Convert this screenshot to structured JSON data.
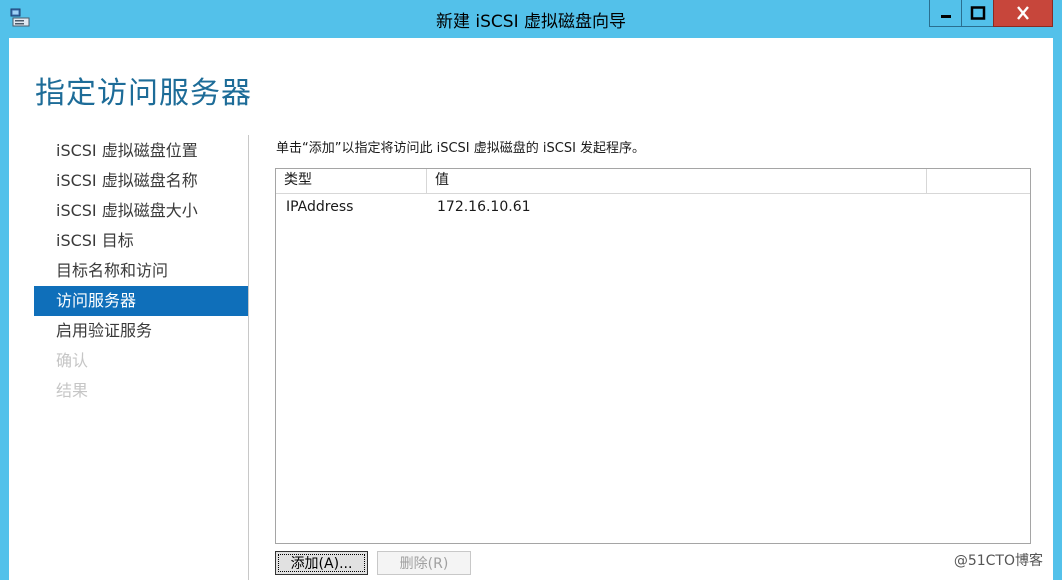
{
  "window": {
    "title": "新建 iSCSI 虚拟磁盘向导",
    "title_bar_color": "#53c1ea",
    "close_color": "#c7463b",
    "buttons": {
      "minimize_icon": "minimize-icon",
      "maximize_icon": "maximize-icon",
      "close_icon": "close-icon"
    }
  },
  "page": {
    "title": "指定访问服务器",
    "accent_color": "#1d6c98"
  },
  "steps": [
    {
      "label": "iSCSI 虚拟磁盘位置",
      "state": "done"
    },
    {
      "label": "iSCSI 虚拟磁盘名称",
      "state": "done"
    },
    {
      "label": "iSCSI 虚拟磁盘大小",
      "state": "done"
    },
    {
      "label": "iSCSI 目标",
      "state": "done"
    },
    {
      "label": "目标名称和访问",
      "state": "done"
    },
    {
      "label": "访问服务器",
      "state": "active"
    },
    {
      "label": "启用验证服务",
      "state": "pending"
    },
    {
      "label": "确认",
      "state": "disabled"
    },
    {
      "label": "结果",
      "state": "disabled"
    }
  ],
  "main": {
    "instruction": "单击“添加”以指定将访问此 iSCSI 虚拟磁盘的 iSCSI 发起程序。",
    "table": {
      "columns": [
        "类型",
        "值",
        ""
      ],
      "rows": [
        {
          "type": "IPAddress",
          "value": "172.16.10.61"
        }
      ]
    },
    "add_button": "添加(A)...",
    "remove_button": "删除(R)"
  },
  "watermark": "@51CTO博客"
}
